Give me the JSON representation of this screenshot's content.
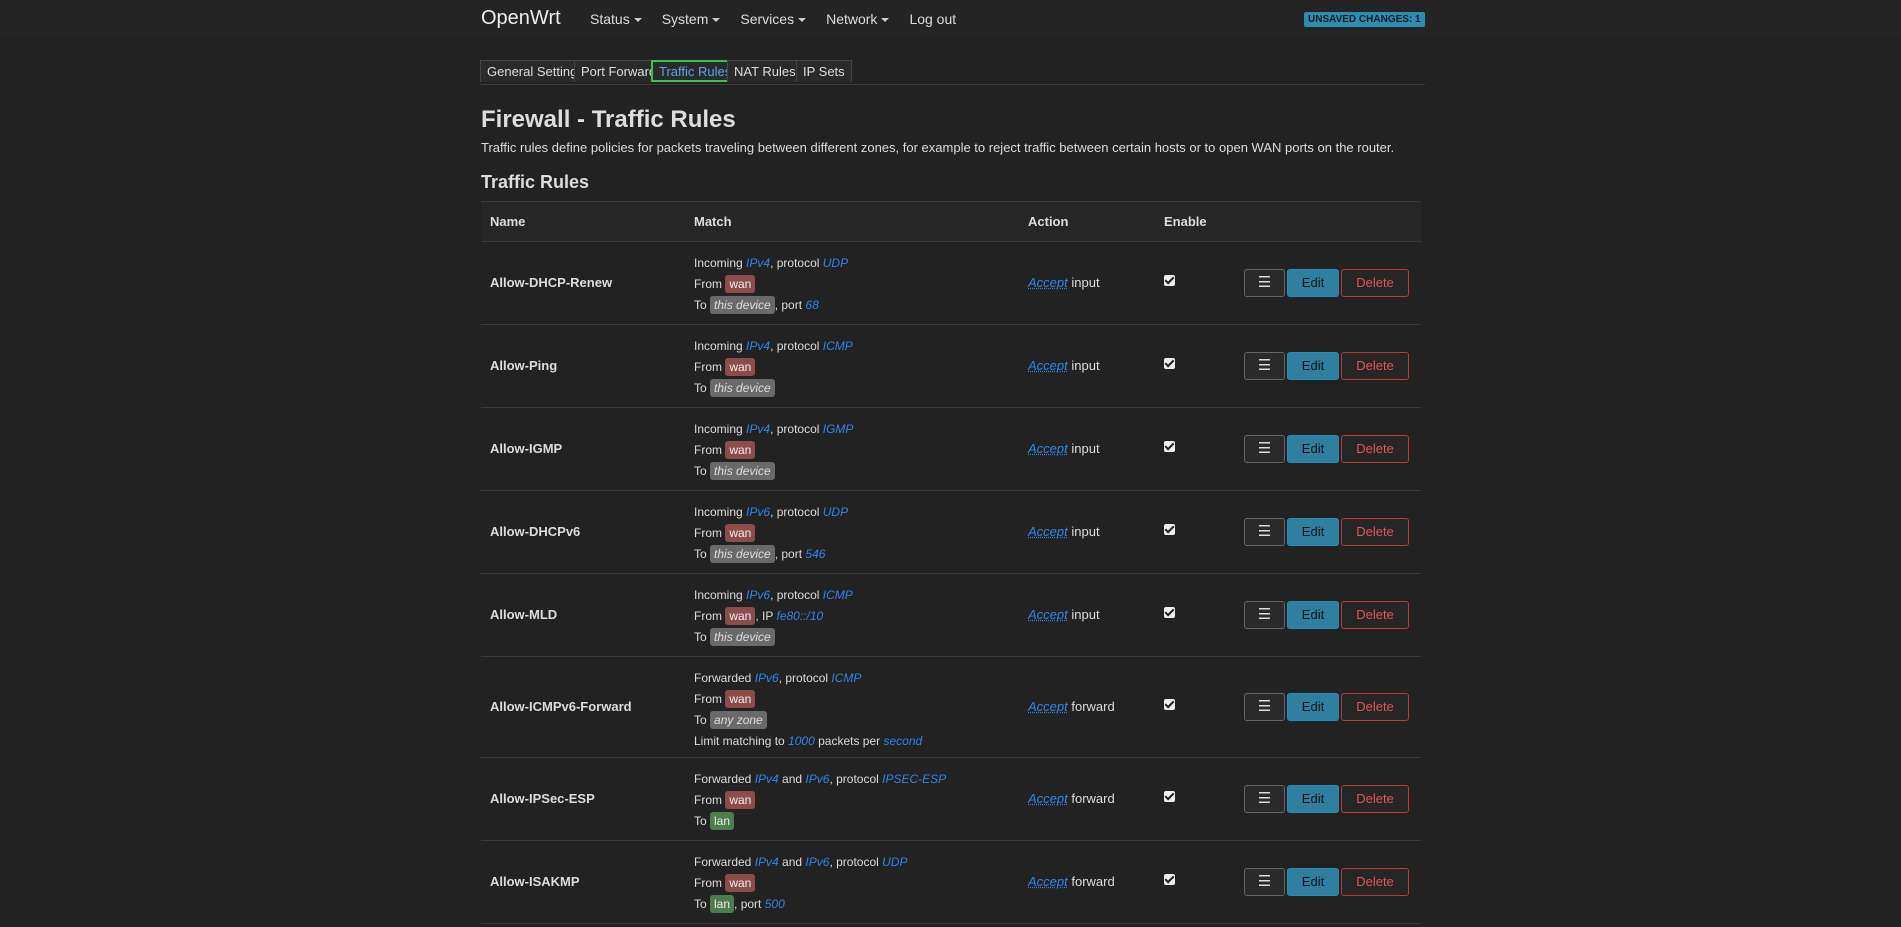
{
  "header": {
    "brand": "OpenWrt",
    "menu": [
      {
        "label": "Status",
        "dropdown": true
      },
      {
        "label": "System",
        "dropdown": true
      },
      {
        "label": "Services",
        "dropdown": true
      },
      {
        "label": "Network",
        "dropdown": true
      },
      {
        "label": "Log out",
        "dropdown": false
      }
    ],
    "unsaved_label": "UNSAVED CHANGES: 1"
  },
  "tabs": [
    {
      "label": "General Settings",
      "active": false
    },
    {
      "label": "Port Forwards",
      "active": false
    },
    {
      "label": "Traffic Rules",
      "active": true
    },
    {
      "label": "NAT Rules",
      "active": false
    },
    {
      "label": "IP Sets",
      "active": false
    }
  ],
  "page": {
    "title": "Firewall - Traffic Rules",
    "description": "Traffic rules define policies for packets traveling between different zones, for example to reject traffic between certain hosts or to open WAN ports on the router.",
    "section_title": "Traffic Rules"
  },
  "table": {
    "columns": {
      "name": "Name",
      "match": "Match",
      "action": "Action",
      "enable": "Enable"
    },
    "buttons": {
      "menu_glyph": "☰",
      "edit": "Edit",
      "delete": "Delete"
    },
    "rows": [
      {
        "name": "Allow-DHCP-Renew",
        "line1": {
          "dir": "Incoming",
          "family": "IPv4",
          "family2": "",
          "protocol": "UDP"
        },
        "from": "wan",
        "from_ip": "",
        "to": "this device",
        "to_kind": "dev",
        "port": "68",
        "limit": null,
        "action": "Accept",
        "action_target": "input",
        "enabled": true
      },
      {
        "name": "Allow-Ping",
        "line1": {
          "dir": "Incoming",
          "family": "IPv4",
          "family2": "",
          "protocol": "ICMP"
        },
        "from": "wan",
        "from_ip": "",
        "to": "this device",
        "to_kind": "dev",
        "port": "",
        "limit": null,
        "action": "Accept",
        "action_target": "input",
        "enabled": true
      },
      {
        "name": "Allow-IGMP",
        "line1": {
          "dir": "Incoming",
          "family": "IPv4",
          "family2": "",
          "protocol": "IGMP"
        },
        "from": "wan",
        "from_ip": "",
        "to": "this device",
        "to_kind": "dev",
        "port": "",
        "limit": null,
        "action": "Accept",
        "action_target": "input",
        "enabled": true
      },
      {
        "name": "Allow-DHCPv6",
        "line1": {
          "dir": "Incoming",
          "family": "IPv6",
          "family2": "",
          "protocol": "UDP"
        },
        "from": "wan",
        "from_ip": "",
        "to": "this device",
        "to_kind": "dev",
        "port": "546",
        "limit": null,
        "action": "Accept",
        "action_target": "input",
        "enabled": true
      },
      {
        "name": "Allow-MLD",
        "line1": {
          "dir": "Incoming",
          "family": "IPv6",
          "family2": "",
          "protocol": "ICMP"
        },
        "from": "wan",
        "from_ip": "fe80::/10",
        "to": "this device",
        "to_kind": "dev",
        "port": "",
        "limit": null,
        "action": "Accept",
        "action_target": "input",
        "enabled": true
      },
      {
        "name": "Allow-ICMPv6-Forward",
        "line1": {
          "dir": "Forwarded",
          "family": "IPv6",
          "family2": "",
          "protocol": "ICMP"
        },
        "from": "wan",
        "from_ip": "",
        "to": "any zone",
        "to_kind": "dev",
        "port": "",
        "limit": {
          "prefix": "Limit matching to",
          "value": "1000",
          "mid": "packets per",
          "unit": "second"
        },
        "action": "Accept",
        "action_target": "forward",
        "enabled": true
      },
      {
        "name": "Allow-IPSec-ESP",
        "line1": {
          "dir": "Forwarded",
          "family": "IPv4",
          "family2": "IPv6",
          "protocol": "IPSEC-ESP"
        },
        "from": "wan",
        "from_ip": "",
        "to": "lan",
        "to_kind": "lan",
        "port": "",
        "limit": null,
        "action": "Accept",
        "action_target": "forward",
        "enabled": true
      },
      {
        "name": "Allow-ISAKMP",
        "line1": {
          "dir": "Forwarded",
          "family": "IPv4",
          "family2": "IPv6",
          "protocol": "UDP"
        },
        "from": "wan",
        "from_ip": "",
        "to": "lan",
        "to_kind": "lan",
        "port": "500",
        "limit": null,
        "action": "Accept",
        "action_target": "forward",
        "enabled": true
      }
    ]
  }
}
